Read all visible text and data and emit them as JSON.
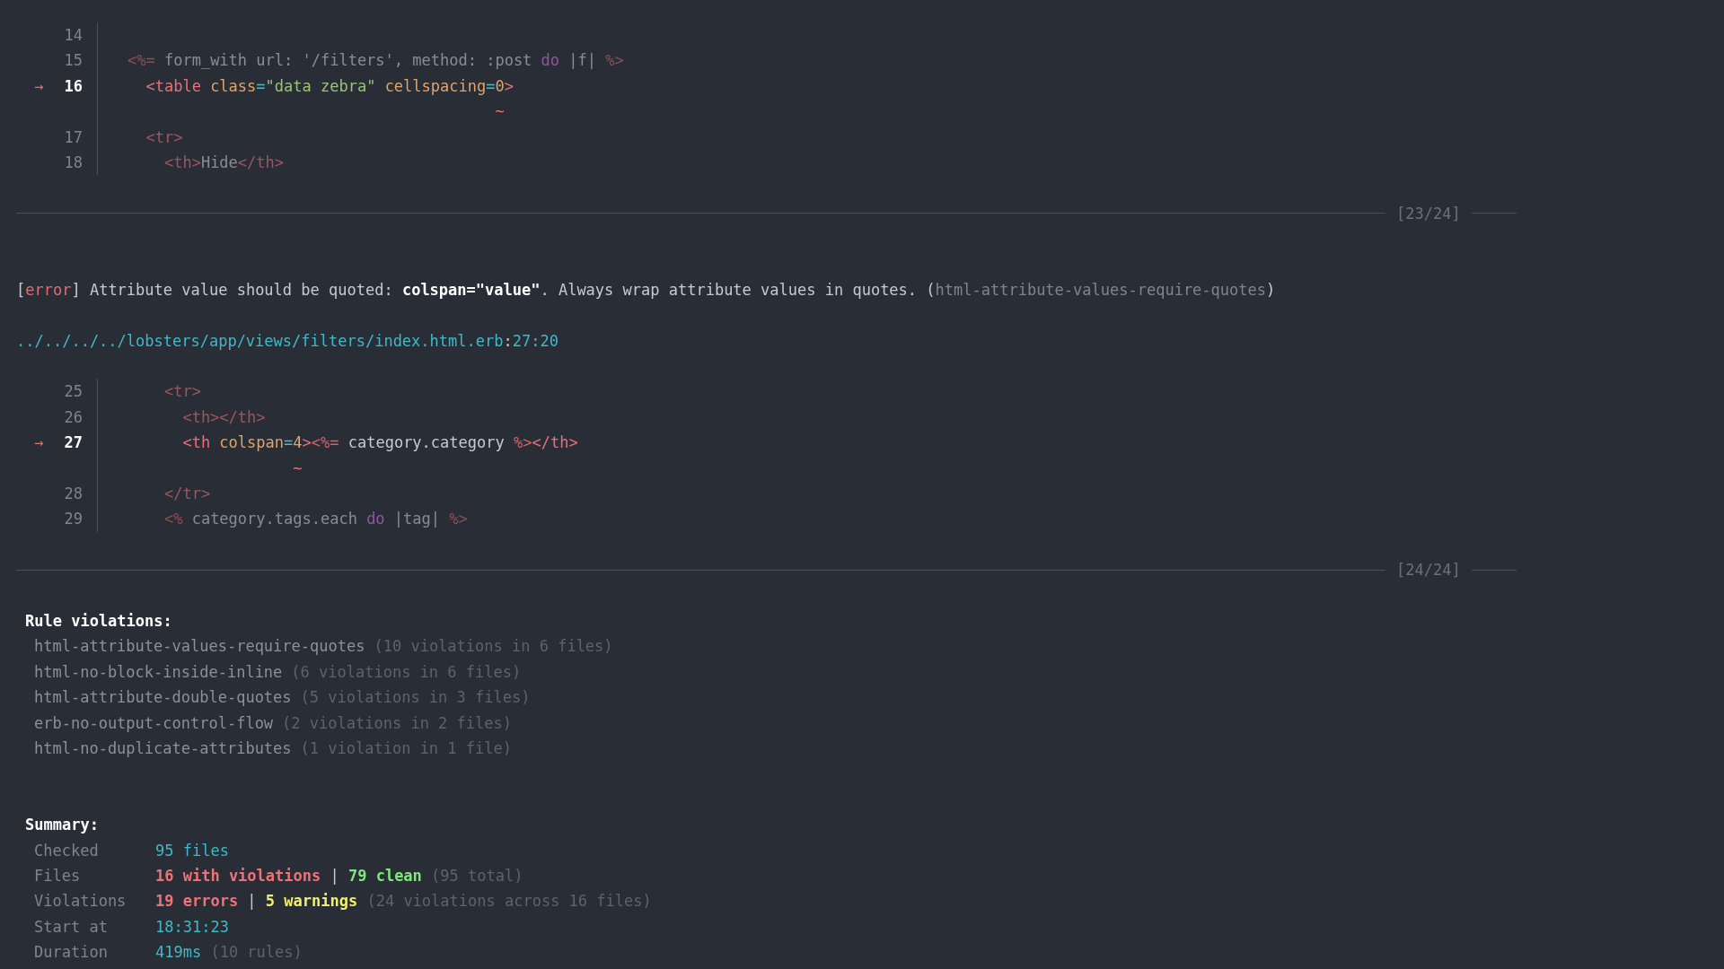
{
  "top_excerpt": {
    "lines": [
      {
        "kind": "code",
        "number": "14",
        "current": false
      },
      {
        "kind": "code",
        "number": "15",
        "current": false,
        "tokens": [
          {
            "kind": "erb",
            "text": "<%="
          },
          {
            "kind": "ruby",
            "text": " form_with url: '/filters', method: :post "
          },
          {
            "kind": "keyword",
            "text": "do"
          },
          {
            "kind": "ruby",
            "text": " |f| "
          },
          {
            "kind": "erb",
            "text": "%>"
          }
        ]
      },
      {
        "kind": "code",
        "number": "16",
        "current": true,
        "marker": "→",
        "tokens": [
          {
            "kind": "tag",
            "text": "  <table"
          },
          {
            "kind": "attr",
            "text": " class"
          },
          {
            "kind": "equals",
            "text": "="
          },
          {
            "kind": "string",
            "text": "\"data zebra\""
          },
          {
            "kind": "attr",
            "text": " cellspacing"
          },
          {
            "kind": "equals",
            "text": "="
          },
          {
            "kind": "number",
            "text": "0"
          },
          {
            "kind": "tag",
            "text": ">"
          }
        ]
      },
      {
        "kind": "pointer",
        "text": "                                        ~"
      },
      {
        "kind": "code",
        "number": "17",
        "current": false,
        "tokens": [
          {
            "kind": "tag",
            "text": "  <tr>"
          }
        ]
      },
      {
        "kind": "code",
        "number": "18",
        "current": false,
        "tokens": [
          {
            "kind": "tag",
            "text": "    <th>"
          },
          {
            "kind": "text",
            "text": "Hide"
          },
          {
            "kind": "tag",
            "text": "</th>"
          }
        ]
      }
    ]
  },
  "divider_first": {
    "label": "[23/24]"
  },
  "diagnostic": {
    "message": [
      {
        "kind": "plain",
        "text": "["
      },
      {
        "kind": "severity",
        "text": "error"
      },
      {
        "kind": "plain",
        "text": "] Attribute value should be quoted: "
      },
      {
        "kind": "bold",
        "text": "colspan=\"value\""
      },
      {
        "kind": "plain",
        "text": ". Always wrap attribute values in quotes. ("
      },
      {
        "kind": "rule",
        "text": "html-attribute-values-require-quotes"
      },
      {
        "kind": "plain",
        "text": ")"
      }
    ],
    "location": [
      {
        "kind": "path",
        "text": "../../../../lobsters/app/views/filters/index.html.erb"
      },
      {
        "kind": "plain",
        "text": ":"
      },
      {
        "kind": "path",
        "text": "27:20"
      }
    ]
  },
  "excerpt": {
    "lines": [
      {
        "kind": "code",
        "number": "25",
        "current": false,
        "tokens": [
          {
            "kind": "tag",
            "text": "    <tr>"
          }
        ]
      },
      {
        "kind": "code",
        "number": "26",
        "current": false,
        "tokens": [
          {
            "kind": "tag",
            "text": "      <th></th>"
          }
        ]
      },
      {
        "kind": "code",
        "number": "27",
        "current": true,
        "marker": "→",
        "tokens": [
          {
            "kind": "tag",
            "text": "      <th"
          },
          {
            "kind": "attr",
            "text": " colspan"
          },
          {
            "kind": "equals",
            "text": "="
          },
          {
            "kind": "number",
            "text": "4"
          },
          {
            "kind": "tag",
            "text": ">"
          },
          {
            "kind": "erb",
            "text": "<%="
          },
          {
            "kind": "ruby",
            "text": " category.category "
          },
          {
            "kind": "erb",
            "text": "%>"
          },
          {
            "kind": "tag",
            "text": "</th>"
          }
        ]
      },
      {
        "kind": "pointer",
        "text": "                  ~"
      },
      {
        "kind": "code",
        "number": "28",
        "current": false,
        "tokens": [
          {
            "kind": "tag",
            "text": "    </tr>"
          }
        ]
      },
      {
        "kind": "code",
        "number": "29",
        "current": false,
        "tokens": [
          {
            "kind": "erb",
            "text": "    <%"
          },
          {
            "kind": "ruby",
            "text": " category.tags.each "
          },
          {
            "kind": "keyword",
            "text": "do"
          },
          {
            "kind": "ruby",
            "text": " |tag| "
          },
          {
            "kind": "erb",
            "text": "%>"
          }
        ]
      }
    ]
  },
  "divider_second": {
    "label": "[24/24]"
  },
  "rule_violations": {
    "title": "Rule violations:",
    "items": [
      {
        "rule": "html-attribute-values-require-quotes",
        "count": "(10 violations in 6 files)"
      },
      {
        "rule": "html-no-block-inside-inline",
        "count": "(6 violations in 6 files)"
      },
      {
        "rule": "html-attribute-double-quotes",
        "count": "(5 violations in 3 files)"
      },
      {
        "rule": "erb-no-output-control-flow",
        "count": "(2 violations in 2 files)"
      },
      {
        "rule": "html-no-duplicate-attributes",
        "count": "(1 violation in 1 file)"
      }
    ]
  },
  "summary": {
    "title": "Summary:",
    "rows": [
      {
        "label": "Checked",
        "tokens": [
          {
            "kind": "info",
            "text": "95 files"
          }
        ]
      },
      {
        "label": "Files",
        "tokens": [
          {
            "kind": "bad",
            "text": "16 with violations"
          },
          {
            "kind": "plain",
            "text": " | "
          },
          {
            "kind": "good",
            "text": "79 clean"
          },
          {
            "kind": "dim",
            "text": " (95 total)"
          }
        ]
      },
      {
        "label": "Violations",
        "tokens": [
          {
            "kind": "bad",
            "text": "19 errors"
          },
          {
            "kind": "plain",
            "text": " | "
          },
          {
            "kind": "warn",
            "text": "5 warnings"
          },
          {
            "kind": "dim",
            "text": " (24 violations across 16 files)"
          }
        ]
      },
      {
        "label": "Start at",
        "tokens": [
          {
            "kind": "info",
            "text": "18:31:23"
          }
        ]
      },
      {
        "label": "Duration",
        "tokens": [
          {
            "kind": "info",
            "text": "419ms"
          },
          {
            "kind": "dim",
            "text": " (10 rules)"
          }
        ]
      }
    ]
  }
}
